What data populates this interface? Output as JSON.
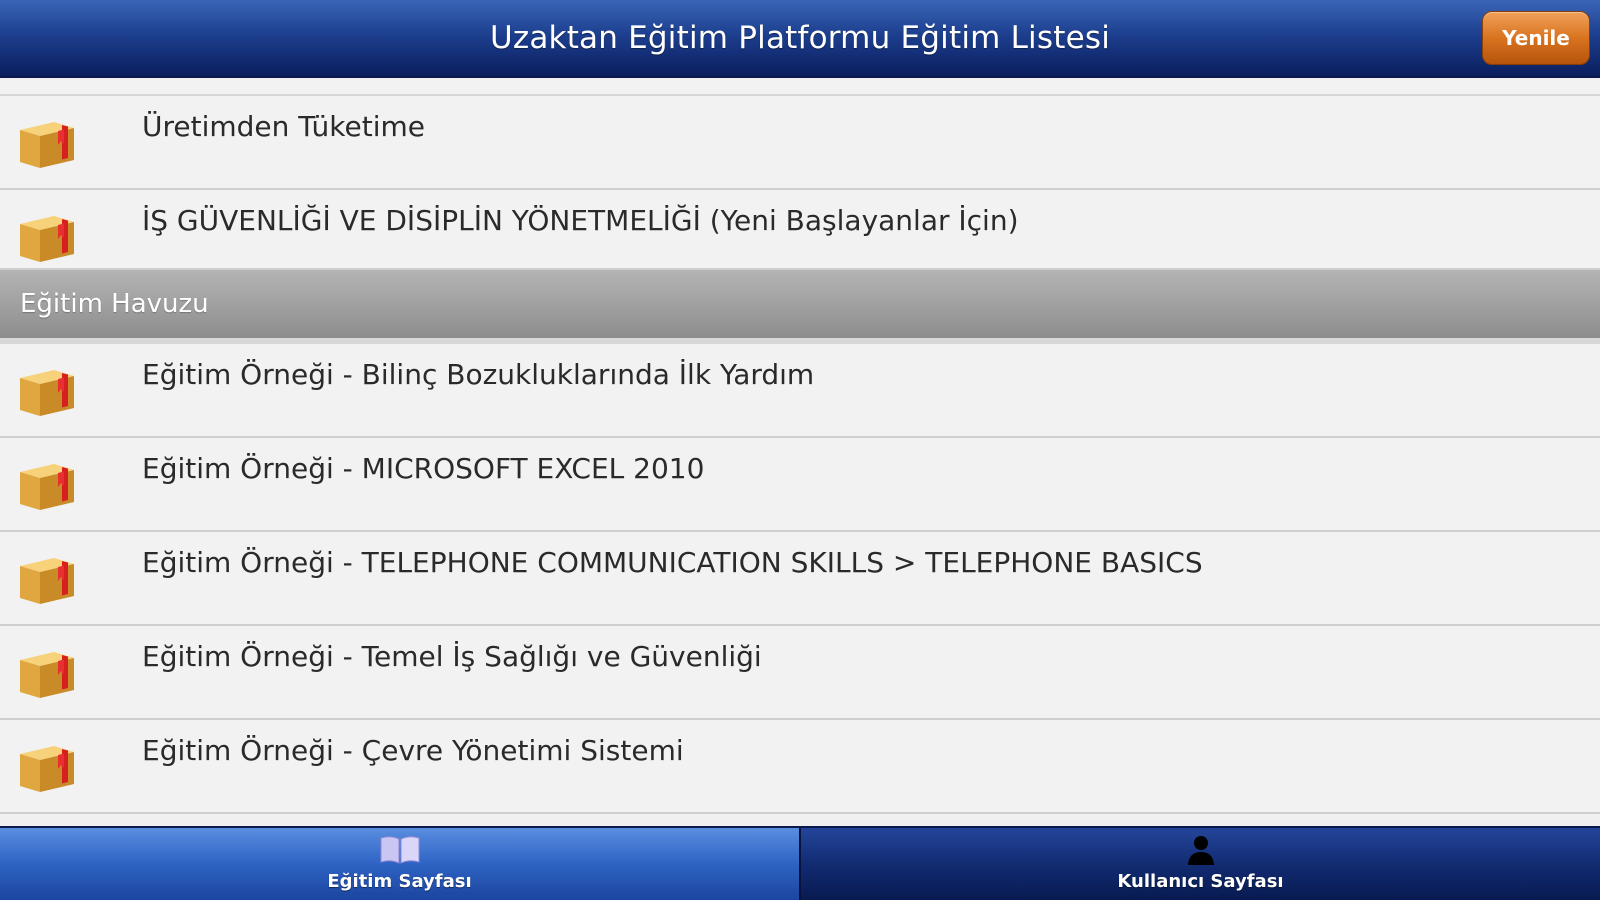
{
  "header": {
    "title": "Uzaktan Eğitim Platformu Eğitim Listesi",
    "refresh_label": "Yenile"
  },
  "assigned_items": [
    {
      "label": "Üretimden Tüketime",
      "icon": "package-box-icon"
    },
    {
      "label": "İŞ GÜVENLİĞİ VE DİSİPLİN YÖNETMELİĞİ (Yeni Başlayanlar İçin)",
      "icon": "package-box-icon"
    }
  ],
  "pool_section": {
    "title": "Eğitim Havuzu",
    "items": [
      {
        "label": "Eğitim Örneği - Bilinç Bozukluklarında İlk Yardım",
        "icon": "package-box-icon"
      },
      {
        "label": "Eğitim Örneği - MICROSOFT EXCEL 2010",
        "icon": "package-box-icon"
      },
      {
        "label": "Eğitim Örneği - TELEPHONE COMMUNICATION SKILLS > TELEPHONE BASICS",
        "icon": "package-box-icon"
      },
      {
        "label": "Eğitim Örneği - Temel İş Sağlığı ve Güvenliği",
        "icon": "package-box-icon"
      },
      {
        "label": "Eğitim Örneği - Çevre Yönetimi Sistemi",
        "icon": "package-box-icon"
      }
    ]
  },
  "tabbar": {
    "tabs": [
      {
        "label": "Eğitim Sayfası",
        "icon": "book-icon",
        "active": true
      },
      {
        "label": "Kullanıcı Sayfası",
        "icon": "user-icon",
        "active": false
      }
    ]
  },
  "colors": {
    "header_dark": "#0b1e5e",
    "header_light": "#3a66b8",
    "refresh_button": "#d9731f",
    "section_header": "#9d9d9d",
    "tab_active": "#2f63c4",
    "tab_inactive": "#122c73"
  }
}
